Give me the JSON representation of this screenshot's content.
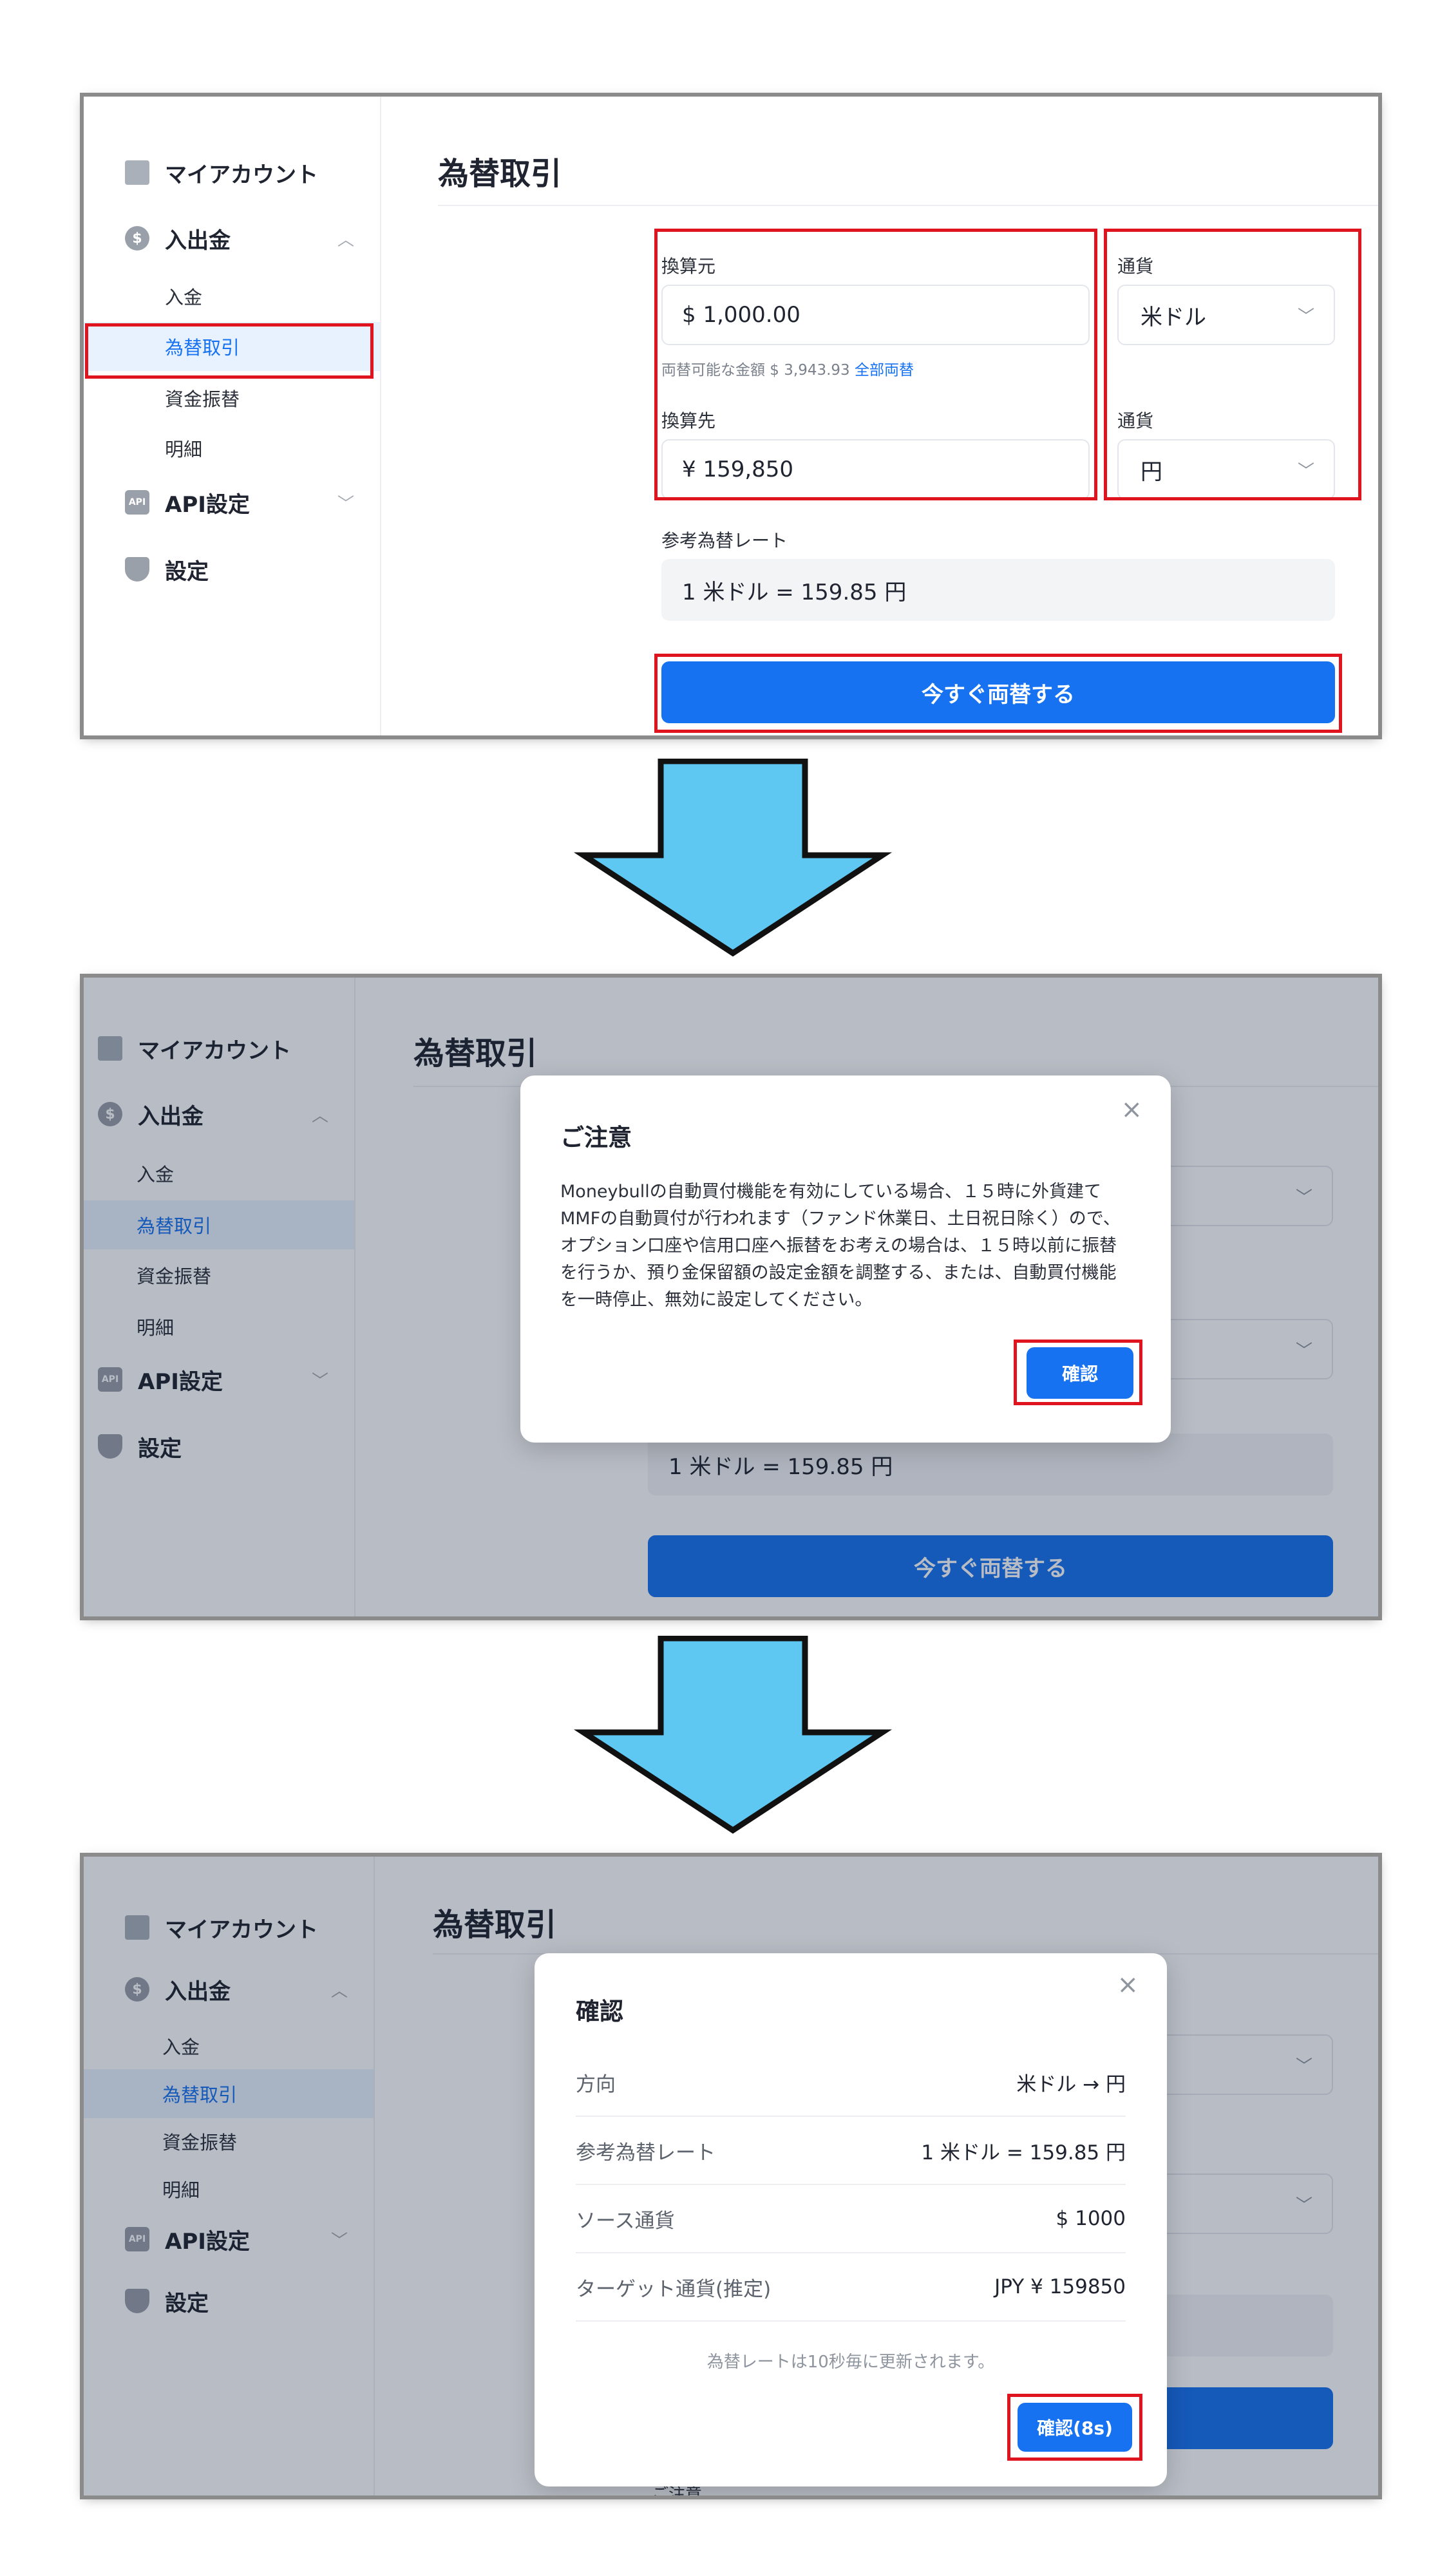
{
  "sidebar": {
    "my_account": "マイアカウント",
    "deposit_withdraw": "入出金",
    "sub_items": [
      "入金",
      "為替取引",
      "資金振替",
      "明細"
    ],
    "api_settings": "API設定",
    "api_badge": "API",
    "settings": "設定"
  },
  "main": {
    "title": "為替取引",
    "source_label": "換算元",
    "source_value": "$ 1,000.00",
    "currency_label": "通貨",
    "source_currency": "米ドル",
    "available_text": "両替可能な金額 $ 3,943.93",
    "exchange_all": "全部両替",
    "target_label": "換算先",
    "target_value": "¥ 159,850",
    "target_currency": "円",
    "rate_label": "参考為替レート",
    "rate_value": "1 米ドル = 159.85 円",
    "exchange_button": "今すぐ両替する",
    "currency_partial": "ル"
  },
  "caution_modal": {
    "title": "ご注意",
    "body": "Moneybullの自動買付機能を有効にしている場合、１５時に外貨建てMMFの自動買付が行われます（ファンド休業日、土日祝日除く）ので、オプション口座や信用口座へ振替をお考えの場合は、１５時以前に振替を行うか、預り金保留額の設定金額を調整する、または、自動買付機能を一時停止、無効に設定してください。",
    "confirm": "確認",
    "close": "×"
  },
  "confirm_modal": {
    "title": "確認",
    "close": "×",
    "rows": [
      {
        "key": "方向",
        "value": "米ドル → 円"
      },
      {
        "key": "参考為替レート",
        "value": "1 米ドル = 159.85 円"
      },
      {
        "key": "ソース通貨",
        "value": "$ 1000"
      },
      {
        "key": "ターゲット通貨(推定)",
        "value": "JPY ¥ 159850"
      }
    ],
    "note": "為替レートは10秒毎に更新されます。",
    "confirm_button": "確認(8s)",
    "bottom_partial": "ご注意"
  },
  "colors": {
    "accent": "#1672f0",
    "highlight": "#e0141e",
    "arrow_fill": "#5ec8f2"
  }
}
